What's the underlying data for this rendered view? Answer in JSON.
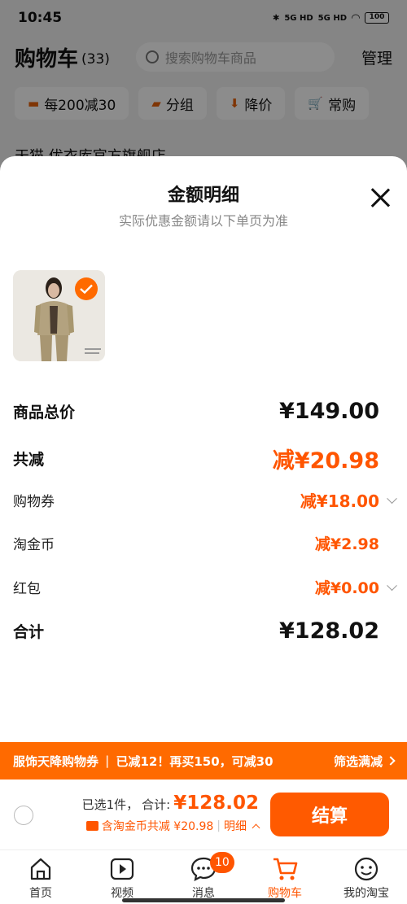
{
  "status_bar": {
    "time": "10:45",
    "net1": "5G HD",
    "net2": "5G HD",
    "battery": "100"
  },
  "background": {
    "title": "购物车",
    "count": "(33)",
    "search_placeholder": "搜索购物车商品",
    "manage": "管理",
    "chips": [
      "每200减30",
      "分组",
      "降价",
      "常购"
    ],
    "shop_row": "天猫 优衣库官方旗舰店"
  },
  "sheet": {
    "title": "金额明细",
    "subtitle": "实际优惠金额请以下单页为准"
  },
  "breakdown": {
    "total_label": "商品总价",
    "total_value": "¥149.00",
    "discount_label": "共减",
    "discount_value": "减¥20.98",
    "coupon_label": "购物券",
    "coupon_value": "减¥18.00",
    "coin_label": "淘金币",
    "coin_value": "减¥2.98",
    "redpacket_label": "红包",
    "redpacket_value": "减¥0.00",
    "sum_label": "合计",
    "sum_value": "¥128.02"
  },
  "promo": {
    "text1": "服饰天降购物券",
    "text2": "已减12！再买150，可减30",
    "link": "筛选满减"
  },
  "checkout": {
    "selected": "已选1件，",
    "sum_label": "合计:",
    "sum_value": "¥128.02",
    "savings": "含淘金币共减 ¥20.98",
    "detail": "明细",
    "button": "结算"
  },
  "tabs": [
    {
      "label": "首页",
      "icon": "home-icon"
    },
    {
      "label": "视频",
      "icon": "video-icon"
    },
    {
      "label": "消息",
      "icon": "message-icon",
      "badge": "10"
    },
    {
      "label": "购物车",
      "icon": "cart-icon"
    },
    {
      "label": "我的淘宝",
      "icon": "profile-icon"
    }
  ],
  "colors": {
    "accent": "#ff5500",
    "promo_bar": "#ff6a00"
  }
}
